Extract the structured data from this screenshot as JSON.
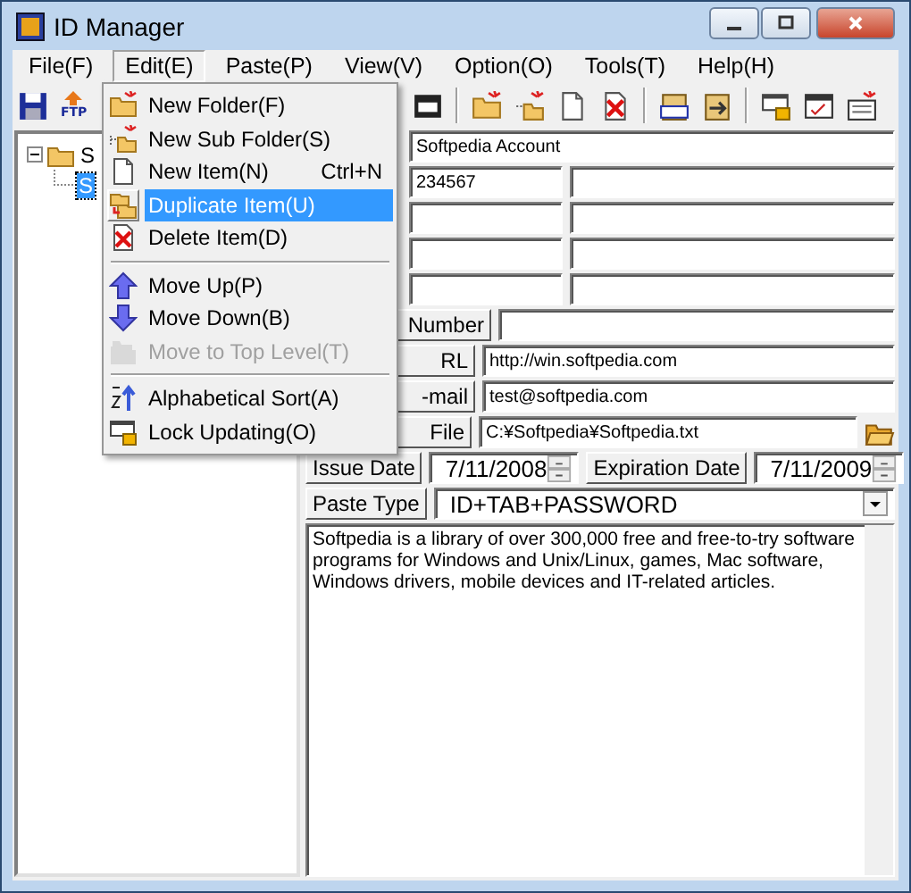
{
  "window": {
    "title": "ID Manager"
  },
  "menu_bar": [
    {
      "label": "File(F)",
      "selected": false
    },
    {
      "label": "Edit(E)",
      "selected": true
    },
    {
      "label": "Paste(P)",
      "selected": false
    },
    {
      "label": "View(V)",
      "selected": false
    },
    {
      "label": "Option(O)",
      "selected": false
    },
    {
      "label": "Tools(T)",
      "selected": false
    },
    {
      "label": "Help(H)",
      "selected": false
    }
  ],
  "toolbar": {
    "ftp_label": "FTP"
  },
  "tree": [
    {
      "label": "S",
      "selected": false,
      "expanded": true,
      "children": [
        {
          "label": "S",
          "selected": true
        }
      ]
    }
  ],
  "form": {
    "title_value": "Softpedia Account",
    "account_value": "234567",
    "number": {
      "label": "Number"
    },
    "url": {
      "label": "RL",
      "value": "http://win.softpedia.com"
    },
    "email": {
      "label": "-mail",
      "value": "test@softpedia.com"
    },
    "file": {
      "label": "File",
      "value": "C:¥Softpedia¥Softpedia.txt"
    },
    "issue_date": {
      "label": "Issue Date",
      "value": "7/11/2008"
    },
    "expiration_date": {
      "label": "Expiration Date",
      "value": "7/11/2009"
    },
    "paste_type": {
      "label": "Paste Type",
      "value": "ID+TAB+PASSWORD"
    },
    "notes": "Softpedia is a library of over 300,000 free and free-to-try software programs for Windows and Unix/Linux, games, Mac software, Windows drivers, mobile devices and IT-related articles."
  },
  "context_menu": [
    {
      "kind": "item",
      "label": "New Folder(F)",
      "selected": false,
      "disabled": false
    },
    {
      "kind": "item",
      "label": "New Sub Folder(S)",
      "selected": false,
      "disabled": false
    },
    {
      "kind": "item",
      "label": "New Item(N)",
      "shortcut": "Ctrl+N",
      "selected": false,
      "disabled": false
    },
    {
      "kind": "item",
      "label": "Duplicate Item(U)",
      "selected": true,
      "disabled": false
    },
    {
      "kind": "item",
      "label": "Delete Item(D)",
      "selected": false,
      "disabled": false
    },
    {
      "kind": "separator"
    },
    {
      "kind": "item",
      "label": "Move Up(P)",
      "selected": false,
      "disabled": false
    },
    {
      "kind": "item",
      "label": "Move Down(B)",
      "selected": false,
      "disabled": false
    },
    {
      "kind": "item",
      "label": "Move to Top Level(T)",
      "selected": false,
      "disabled": true
    },
    {
      "kind": "separator"
    },
    {
      "kind": "item",
      "label": "Alphabetical Sort(A)",
      "selected": false,
      "disabled": false
    },
    {
      "kind": "item",
      "label": "Lock Updating(O)",
      "selected": false,
      "disabled": false
    }
  ]
}
